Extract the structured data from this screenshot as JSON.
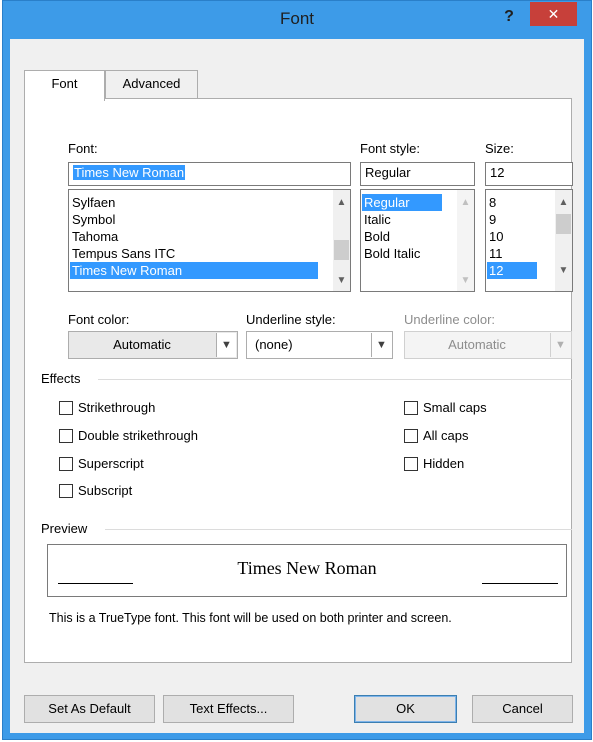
{
  "window": {
    "title": "Font",
    "help_label": "?",
    "close_label": "✕"
  },
  "tabs": [
    {
      "label": "Font",
      "active": true
    },
    {
      "label": "Advanced",
      "active": false
    }
  ],
  "font": {
    "label": "Font:",
    "value": "Times New Roman",
    "list": [
      "Sylfaen",
      "Symbol",
      "Tahoma",
      "Tempus Sans ITC",
      "Times New Roman"
    ],
    "selected": "Times New Roman"
  },
  "font_style": {
    "label": "Font style:",
    "value": "Regular",
    "list": [
      "Regular",
      "Italic",
      "Bold",
      "Bold Italic"
    ],
    "selected": "Regular"
  },
  "size": {
    "label": "Size:",
    "value": "12",
    "list": [
      "8",
      "9",
      "10",
      "11",
      "12"
    ],
    "selected": "12"
  },
  "font_color": {
    "label": "Font color:",
    "value": "Automatic"
  },
  "underline_style": {
    "label": "Underline style:",
    "value": "(none)"
  },
  "underline_color": {
    "label": "Underline color:",
    "value": "Automatic",
    "disabled": true
  },
  "effects": {
    "heading": "Effects",
    "left": [
      {
        "label": "Strikethrough",
        "checked": false
      },
      {
        "label": "Double strikethrough",
        "checked": false
      },
      {
        "label": "Superscript",
        "checked": false
      },
      {
        "label": "Subscript",
        "checked": false
      }
    ],
    "right": [
      {
        "label": "Small caps",
        "checked": false
      },
      {
        "label": "All caps",
        "checked": false
      },
      {
        "label": "Hidden",
        "checked": false
      }
    ]
  },
  "preview": {
    "heading": "Preview",
    "sample": "Times New Roman",
    "note": "This is a TrueType font. This font will be used on both printer and screen."
  },
  "buttons": {
    "set_default": "Set As Default",
    "text_effects": "Text Effects...",
    "ok": "OK",
    "cancel": "Cancel"
  },
  "colors": {
    "title_bar": "#3d9be8",
    "close_button": "#c7403a",
    "selection": "#3399ff"
  }
}
